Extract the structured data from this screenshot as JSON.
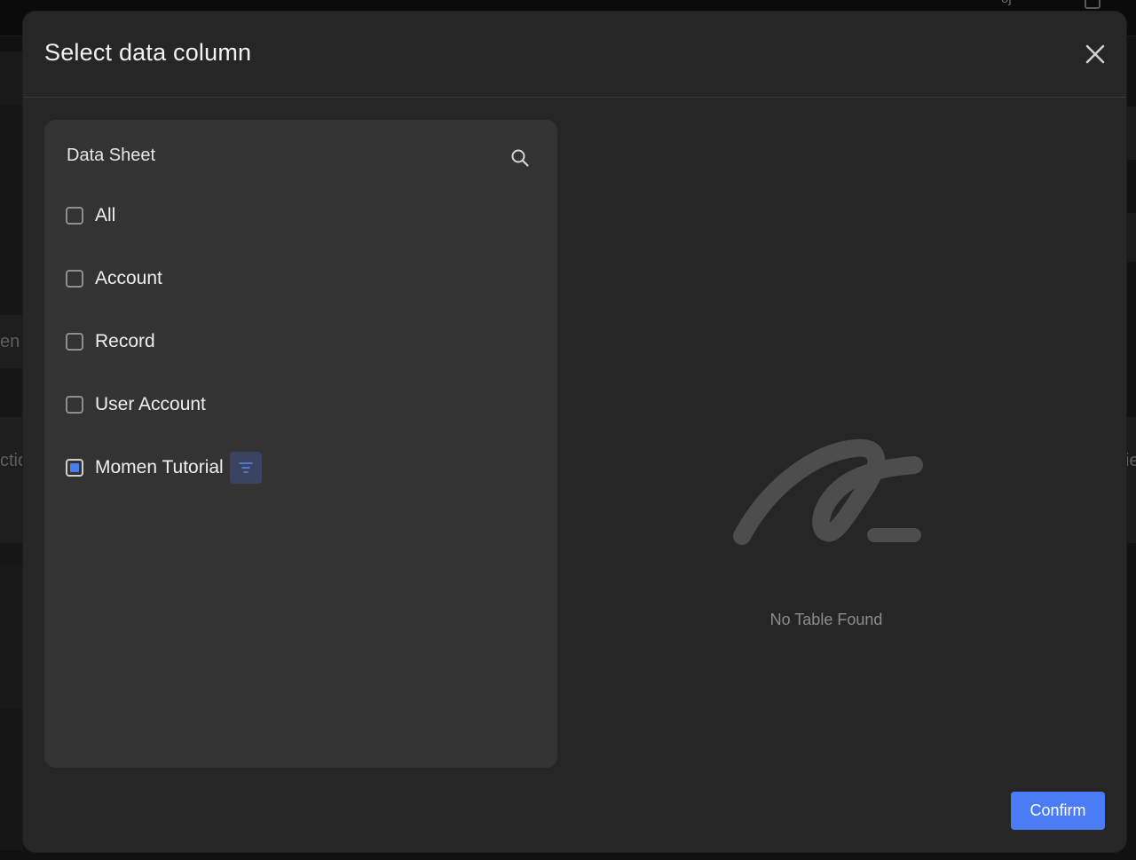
{
  "background": {
    "top_text": "oj",
    "left_fragments": [
      "en",
      "ctic"
    ],
    "right_fragment": "ie"
  },
  "modal": {
    "title": "Select data column",
    "close_icon": "close-icon"
  },
  "left_panel": {
    "title": "Data Sheet",
    "search_icon": "search-icon",
    "items": [
      {
        "label": "All",
        "state": "unchecked"
      },
      {
        "label": "Account",
        "state": "unchecked"
      },
      {
        "label": "Record",
        "state": "unchecked"
      },
      {
        "label": "User Account",
        "state": "unchecked"
      },
      {
        "label": "Momen Tutorial",
        "state": "indeterminate",
        "has_filter": true
      }
    ]
  },
  "right_panel": {
    "empty_text": "No Table Found",
    "empty_icon": "empty-scribble-icon"
  },
  "footer": {
    "confirm_label": "Confirm"
  },
  "colors": {
    "accent": "#4a7cf6",
    "modal_bg": "#262626",
    "panel_bg": "#333333"
  }
}
